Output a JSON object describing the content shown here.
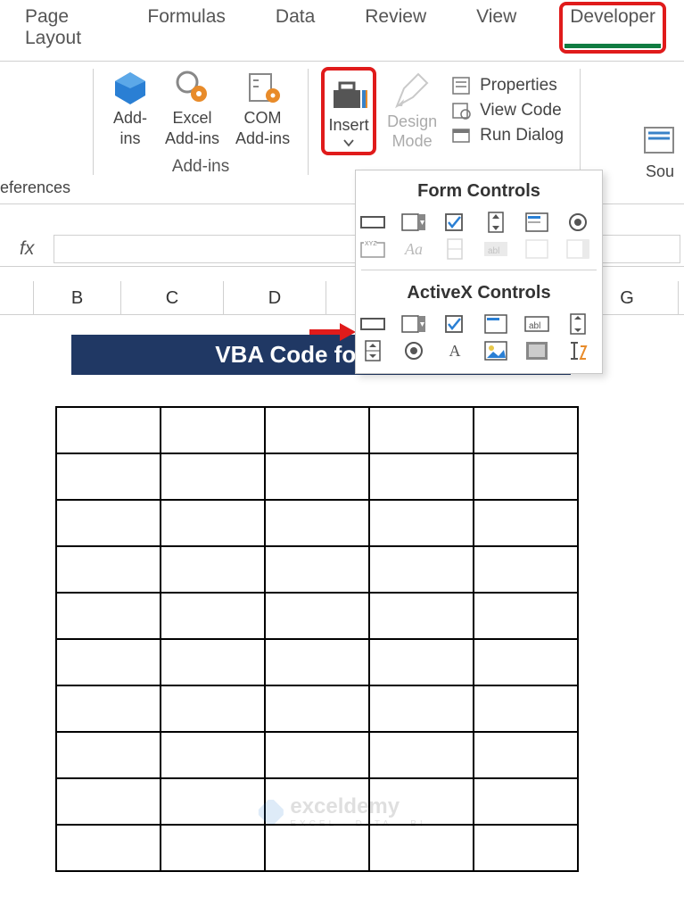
{
  "tabs": {
    "t0": "Page Layout",
    "t1": "Formulas",
    "t2": "Data",
    "t3": "Review",
    "t4": "View",
    "t5": "Developer"
  },
  "ribbon": {
    "references_partial": "eferences",
    "addins": "Add-\nins",
    "excel_addins": "Excel\nAdd-ins",
    "com_addins": "COM\nAdd-ins",
    "group_addins": "Add-ins",
    "insert": "Insert",
    "design_mode": "Design\nMode",
    "properties": "Properties",
    "view_code": "View Code",
    "run_dialog": "Run Dialog",
    "source_partial": "Sou"
  },
  "dropdown": {
    "section1": "Form Controls",
    "section2": "ActiveX Controls"
  },
  "formula": {
    "fx": "fx"
  },
  "columns": {
    "b": "B",
    "c": "C",
    "d": "D",
    "g": "G"
  },
  "banner": "VBA Code for Each",
  "watermark": {
    "name": "exceldemy",
    "tagline": "EXCEL · DATA · BI"
  }
}
